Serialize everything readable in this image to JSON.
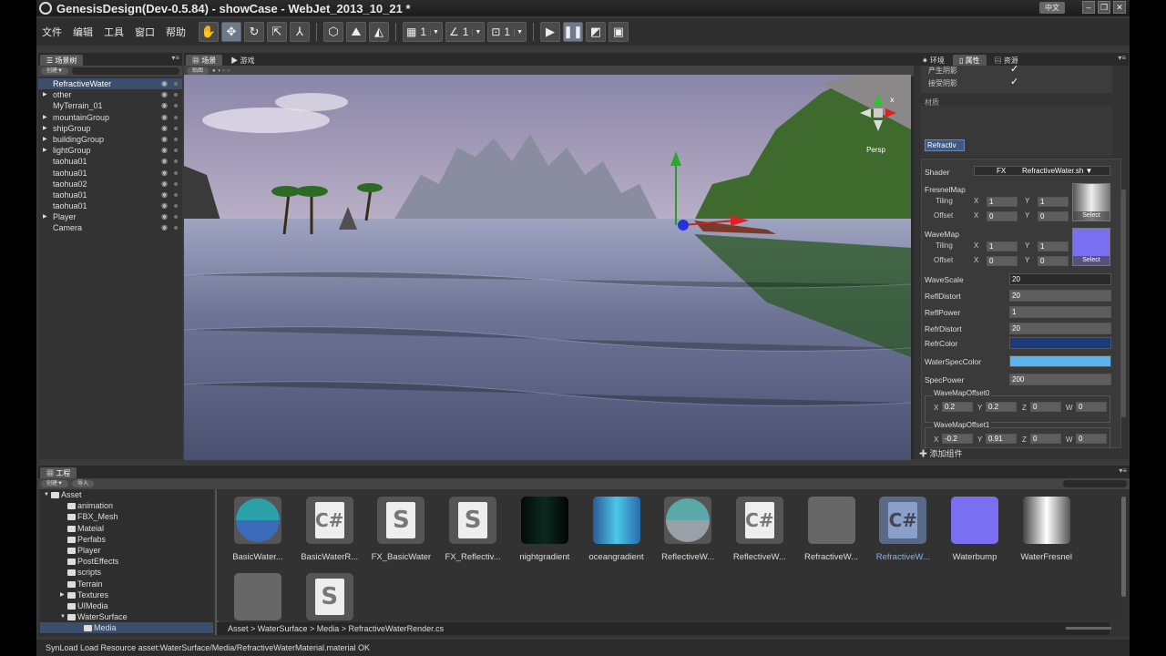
{
  "window": {
    "title": "GenesisDesign(Dev-0.5.84) - showCase - WebJet_2013_10_21 *",
    "lang": "中文"
  },
  "menu": [
    "文件",
    "编辑",
    "工具",
    "窗口",
    "帮助"
  ],
  "toolbar": {
    "grid_count": "1",
    "angle_count": "1",
    "scale_count": "1"
  },
  "hierarchy": {
    "tab": "场景树",
    "create": "创建▼",
    "items": [
      {
        "label": "RefractiveWater",
        "expand": false,
        "selected": true
      },
      {
        "label": "other",
        "expand": true
      },
      {
        "label": "MyTerrain_01",
        "expand": false
      },
      {
        "label": "mountainGroup",
        "expand": true
      },
      {
        "label": "shipGroup",
        "expand": true
      },
      {
        "label": "buildingGroup",
        "expand": true
      },
      {
        "label": "lightGroup",
        "expand": true
      },
      {
        "label": "taohua01",
        "expand": false
      },
      {
        "label": "taohua01",
        "expand": false
      },
      {
        "label": "taohua02",
        "expand": false
      },
      {
        "label": "taohua01",
        "expand": false
      },
      {
        "label": "taohua01",
        "expand": false
      },
      {
        "label": "Player",
        "expand": true
      },
      {
        "label": "Camera",
        "expand": false
      }
    ]
  },
  "viewport": {
    "tab_scene": "场景",
    "tab_game": "游戏",
    "mode": "贴图",
    "persp": "Persp"
  },
  "inspector": {
    "tab_env": "环境",
    "tab_props": "属性",
    "tab_res": "资源",
    "cast_shadow": "产生阴影",
    "recv_shadow": "接受阴影",
    "material": "材质",
    "mat_chip": "Refractiv",
    "shader_label": "Shader",
    "shader_group": "FX",
    "shader_name": "RefractiveWater.sh",
    "fresnel": {
      "label": "FresnelMap",
      "tiling": "Tiling",
      "offset": "Offset",
      "tx": "1",
      "ty": "1",
      "ox": "0",
      "oy": "0",
      "select": "Select"
    },
    "wave": {
      "label": "WaveMap",
      "tiling": "Tiling",
      "offset": "Offset",
      "tx": "1",
      "ty": "1",
      "ox": "0",
      "oy": "0",
      "select": "Select"
    },
    "fields": [
      {
        "label": "WaveScale",
        "value": "20"
      },
      {
        "label": "ReflDistort",
        "value": "20"
      },
      {
        "label": "ReflPower",
        "value": "1"
      },
      {
        "label": "RefrDistort",
        "value": "20"
      }
    ],
    "refr_color_label": "RefrColor",
    "refr_color": "#1a3a7a",
    "spec_color_label": "WaterSpecColor",
    "spec_color": "#5ab4ee",
    "spec_power_label": "SpecPower",
    "spec_power": "200",
    "offset0": {
      "label": "WaveMapOffset0",
      "x": "0.2",
      "y": "0.2",
      "z": "0",
      "w": "0"
    },
    "offset1": {
      "label": "WaveMapOffset1",
      "x": "-0.2",
      "y": "0.91",
      "z": "0",
      "w": "0"
    },
    "add_component": "添加组件",
    "axis": {
      "x": "X",
      "y": "Y",
      "z": "Z",
      "w": "W"
    }
  },
  "project": {
    "tab": "工程",
    "create": "创建▼",
    "import": "导入",
    "folders": [
      {
        "label": "Asset",
        "indent": 0,
        "expand": "▼"
      },
      {
        "label": "animation",
        "indent": 1
      },
      {
        "label": "FBX_Mesh",
        "indent": 1
      },
      {
        "label": "Mateial",
        "indent": 1
      },
      {
        "label": "Perfabs",
        "indent": 1
      },
      {
        "label": "Player",
        "indent": 1
      },
      {
        "label": "PostEffects",
        "indent": 1
      },
      {
        "label": "scripts",
        "indent": 1
      },
      {
        "label": "Terrain",
        "indent": 1
      },
      {
        "label": "Textures",
        "indent": 1,
        "expand": "▶"
      },
      {
        "label": "UIMedia",
        "indent": 1
      },
      {
        "label": "WaterSurface",
        "indent": 1,
        "expand": "▼"
      },
      {
        "label": "Media",
        "indent": 2,
        "selected": true
      }
    ],
    "assets": [
      {
        "name": "BasicWater...",
        "kind": "sphere-teal"
      },
      {
        "name": "BasicWaterR...",
        "kind": "cs"
      },
      {
        "name": "FX_BasicWater",
        "kind": "shader"
      },
      {
        "name": "FX_Reflectiv...",
        "kind": "shader"
      },
      {
        "name": "nightgradient",
        "kind": "night"
      },
      {
        "name": "oceangradient",
        "kind": "ocean"
      },
      {
        "name": "ReflectiveW...",
        "kind": "sphere-grey"
      },
      {
        "name": "ReflectiveW...",
        "kind": "cs"
      },
      {
        "name": "RefractiveW...",
        "kind": "blank"
      },
      {
        "name": "RefractiveW...",
        "kind": "cs-sel",
        "highlight": true
      },
      {
        "name": "Waterbump",
        "kind": "bump"
      },
      {
        "name": "WaterFresnel",
        "kind": "fresnel"
      },
      {
        "name": "",
        "kind": "blank"
      },
      {
        "name": "",
        "kind": "shader"
      }
    ],
    "breadcrumb": "Asset > WaterSurface > Media > RefractiveWaterRender.cs"
  },
  "status": "SynLoad Load Resource asset:WaterSurface/Media/RefractiveWaterMaterial.material OK"
}
